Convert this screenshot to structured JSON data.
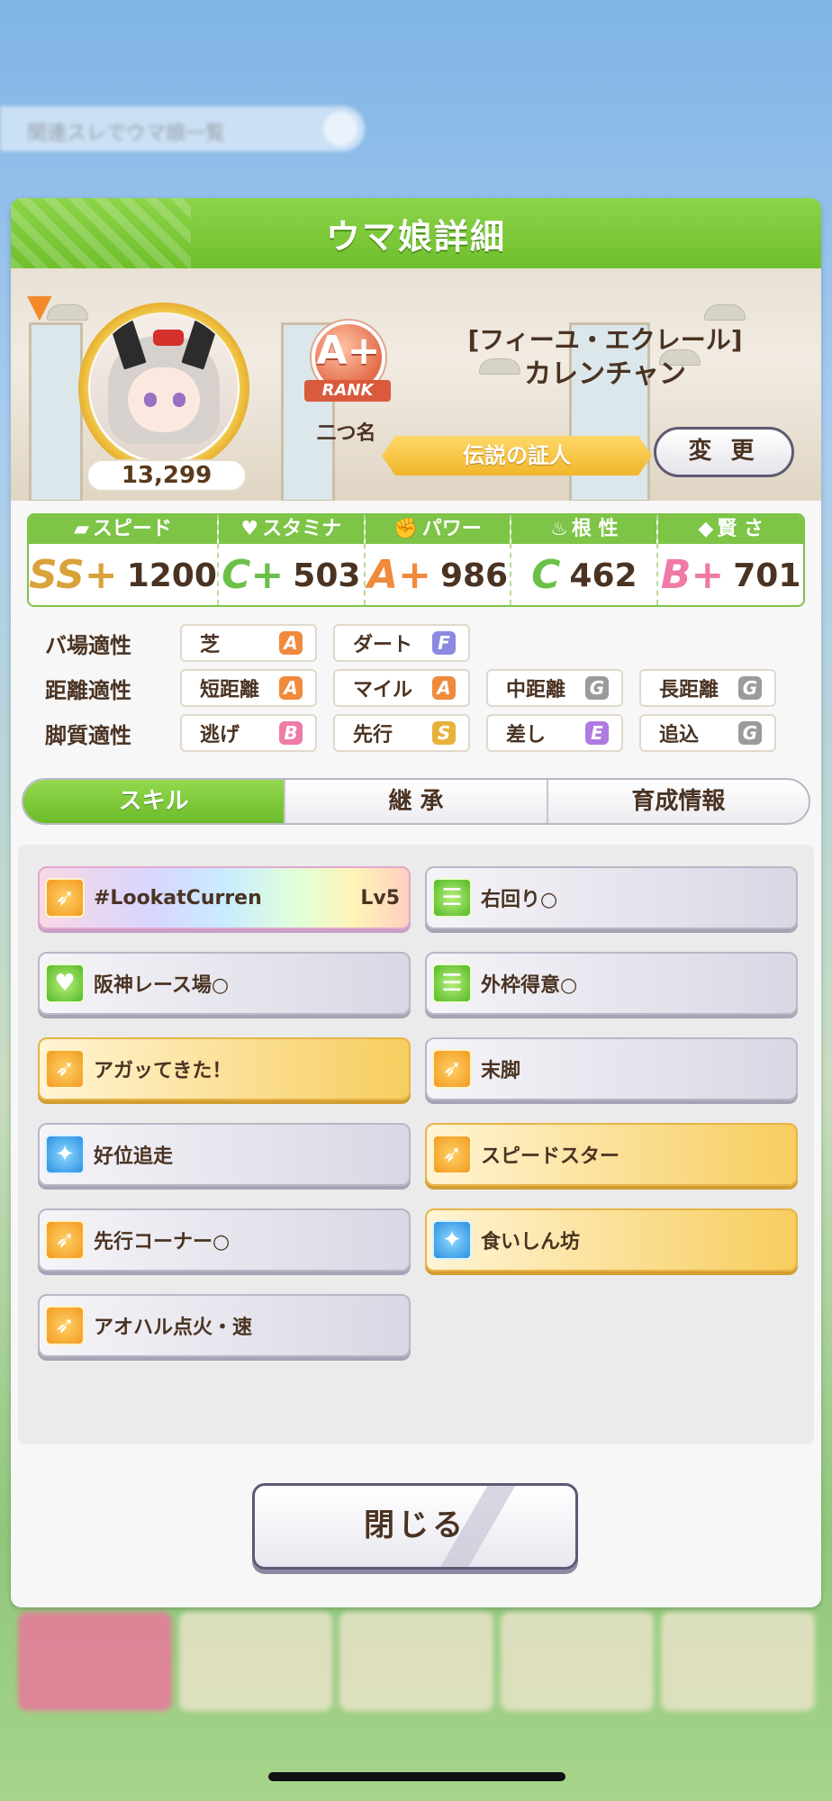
{
  "background": {
    "pill_text": "関連スレでウマ娘一覧"
  },
  "header": {
    "title": "ウマ娘詳細"
  },
  "profile": {
    "fans": "13,299",
    "rank": {
      "grade": "A+",
      "label": "RANK"
    },
    "nickname_label": "二つ名",
    "outfit": "[フィーユ・エクレール]",
    "name": "カレンチャン",
    "title": "伝説の証人",
    "change_button": "変 更"
  },
  "stats": [
    {
      "label": "スピード",
      "icon": "shoe-icon",
      "grade": "SS+",
      "value": "1200",
      "color": "#d9a23a"
    },
    {
      "label": "スタミナ",
      "icon": "heart-icon",
      "grade": "C+",
      "value": "503",
      "color": "#6cc04a"
    },
    {
      "label": "パワー",
      "icon": "muscle-icon",
      "grade": "A+",
      "value": "986",
      "color": "#f08a3c"
    },
    {
      "label": "根 性",
      "icon": "flame-icon",
      "grade": "C",
      "value": "462",
      "color": "#6cc04a"
    },
    {
      "label": "賢 さ",
      "icon": "cap-icon",
      "grade": "B+",
      "value": "701",
      "color": "#ef7aa6"
    }
  ],
  "aptitudes": [
    {
      "label": "バ場適性",
      "items": [
        {
          "name": "芝",
          "grade": "A",
          "color": "#f08a3c"
        },
        {
          "name": "ダート",
          "grade": "F",
          "color": "#8a8ae0"
        }
      ]
    },
    {
      "label": "距離適性",
      "items": [
        {
          "name": "短距離",
          "grade": "A",
          "color": "#f08a3c"
        },
        {
          "name": "マイル",
          "grade": "A",
          "color": "#f08a3c"
        },
        {
          "name": "中距離",
          "grade": "G",
          "color": "#9b9b9b"
        },
        {
          "name": "長距離",
          "grade": "G",
          "color": "#9b9b9b"
        }
      ]
    },
    {
      "label": "脚質適性",
      "items": [
        {
          "name": "逃げ",
          "grade": "B",
          "color": "#ef7aa6"
        },
        {
          "name": "先行",
          "grade": "S",
          "color": "#e7b13a"
        },
        {
          "name": "差し",
          "grade": "E",
          "color": "#b07ae0"
        },
        {
          "name": "追込",
          "grade": "G",
          "color": "#9b9b9b"
        }
      ]
    }
  ],
  "tabs": [
    {
      "label": "スキル",
      "active": true
    },
    {
      "label": "継 承",
      "active": false
    },
    {
      "label": "育成情報",
      "active": false
    }
  ],
  "skills": [
    {
      "name": "#LookatCurren",
      "level": "Lv5",
      "style": "rainbow",
      "icon": "speed-runner-icon",
      "icon_color": "orange"
    },
    {
      "name": "右回り○",
      "level": "",
      "style": "normal",
      "icon": "course-icon",
      "icon_color": "green"
    },
    {
      "name": "阪神レース場○",
      "level": "",
      "style": "normal",
      "icon": "heart-icon",
      "icon_color": "green"
    },
    {
      "name": "外枠得意○",
      "level": "",
      "style": "normal",
      "icon": "course-icon",
      "icon_color": "green"
    },
    {
      "name": "アガッてきた！",
      "level": "",
      "style": "gold",
      "icon": "speed-runner-icon",
      "icon_color": "orange"
    },
    {
      "name": "末脚",
      "level": "",
      "style": "normal",
      "icon": "speed-runner-icon",
      "icon_color": "orange"
    },
    {
      "name": "好位追走",
      "level": "",
      "style": "normal",
      "icon": "sparkle-icon",
      "icon_color": "blue"
    },
    {
      "name": "スピードスター",
      "level": "",
      "style": "gold",
      "icon": "speed-runner-icon",
      "icon_color": "orange"
    },
    {
      "name": "先行コーナー○",
      "level": "",
      "style": "normal",
      "icon": "speed-runner-icon",
      "icon_color": "orange"
    },
    {
      "name": "食いしん坊",
      "level": "",
      "style": "gold",
      "icon": "sparkle-icon",
      "icon_color": "blue"
    },
    {
      "name": "アオハル点火・速",
      "level": "",
      "style": "normal",
      "icon": "speed-runner-icon",
      "icon_color": "orange"
    }
  ],
  "close_button": "閉じる"
}
